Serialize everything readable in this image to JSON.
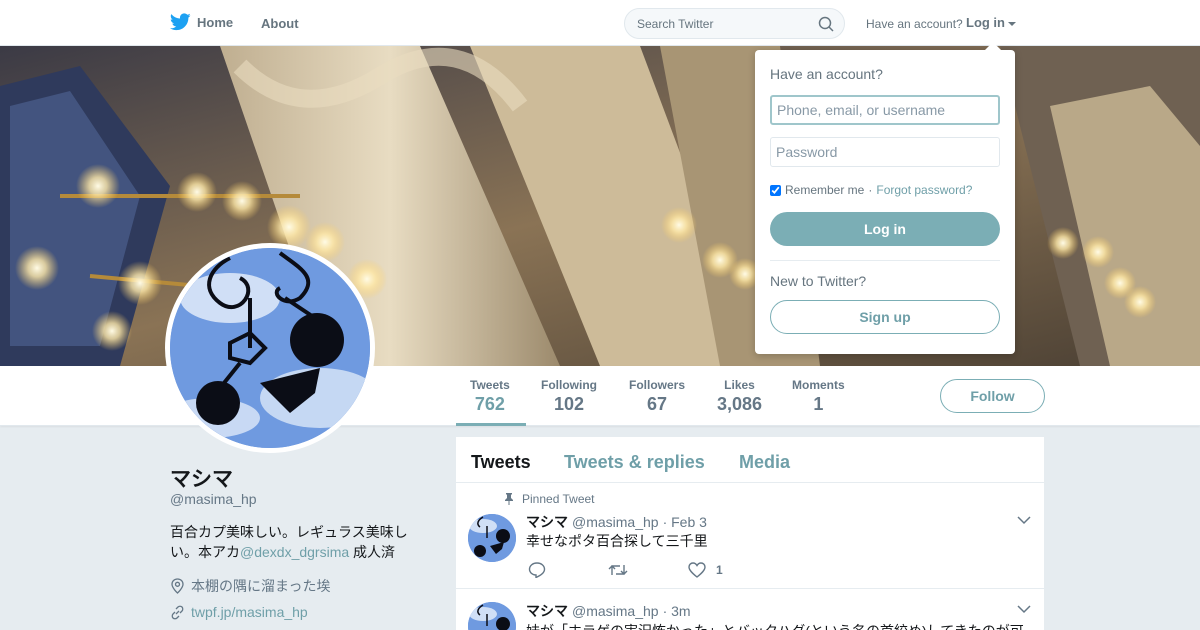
{
  "nav": {
    "home": "Home",
    "about": "About",
    "search_placeholder": "Search Twitter",
    "have_account": "Have an account?",
    "login": "Log in"
  },
  "profile": {
    "name": "マシマ",
    "handle": "@masima_hp",
    "bio_text": "百合カプ美味しい。レギュラス美味しい。本アカ",
    "bio_link": "@dexdx_dgrsima",
    "bio_suffix": " 成人済",
    "location": "本棚の隅に溜まった埃",
    "url": "twpf.jp/masima_hp",
    "follow": "Follow"
  },
  "stats": [
    {
      "label": "Tweets",
      "value": "762"
    },
    {
      "label": "Following",
      "value": "102"
    },
    {
      "label": "Followers",
      "value": "67"
    },
    {
      "label": "Likes",
      "value": "3,086"
    },
    {
      "label": "Moments",
      "value": "1"
    }
  ],
  "tabs": [
    "Tweets",
    "Tweets & replies",
    "Media"
  ],
  "tweets": [
    {
      "pinned": "Pinned Tweet",
      "name": "マシマ",
      "handle": "@masima_hp",
      "time": "· Feb 3",
      "text": "幸せなポタ百合探して三千里",
      "likes": "1"
    },
    {
      "name": "マシマ",
      "handle": "@masima_hp",
      "time": "· 3m",
      "text": "妹が「ホラゲの実況怖かった」とバックハグ(という名の首絞め)してきたのが可"
    }
  ],
  "login_box": {
    "title": "Have an account?",
    "username_placeholder": "Phone, email, or username",
    "password_placeholder": "Password",
    "remember": "Remember me",
    "sep": "·",
    "forgot": "Forgot password?",
    "login_button": "Log in",
    "new_text": "New to Twitter?",
    "signup_button": "Sign up"
  },
  "colors": {
    "accent": "#7baeb5",
    "link": "#6f9fa8"
  }
}
